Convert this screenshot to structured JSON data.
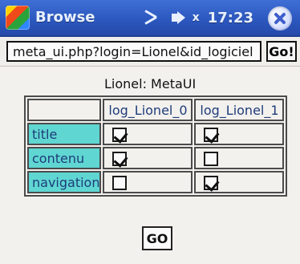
{
  "window": {
    "title": "Browse",
    "time": "17:23",
    "volume_muted_label": "x"
  },
  "address_bar": {
    "value": "meta_ui.php?login=Lionel&id_logiciel",
    "go_label": "Go!"
  },
  "main": {
    "table_title": "Lionel: MetaUI",
    "columns": [
      "log_Lionel_0",
      "log_Lionel_1"
    ],
    "rows": [
      {
        "label": "title",
        "checks": [
          true,
          true
        ]
      },
      {
        "label": "contenu",
        "checks": [
          true,
          false
        ]
      },
      {
        "label": "navigation",
        "checks": [
          false,
          true
        ]
      }
    ],
    "submit_label": "GO"
  }
}
